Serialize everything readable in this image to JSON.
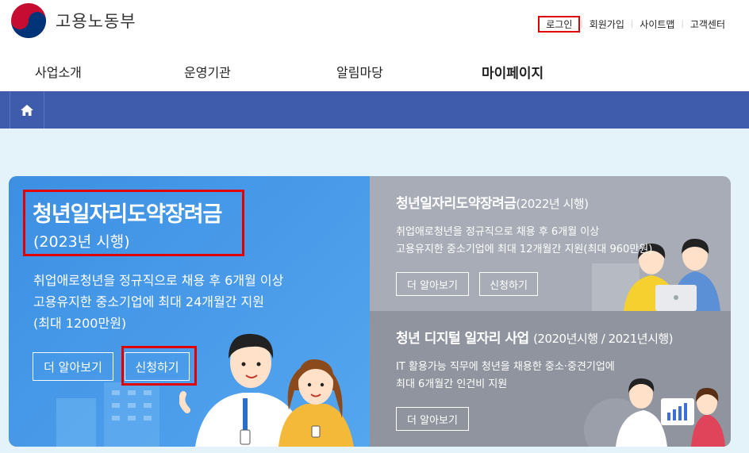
{
  "header": {
    "logo_text": "고용노동부",
    "util_links": [
      "로그인",
      "회원가입",
      "사이트맵",
      "고객센터"
    ]
  },
  "gnb": {
    "items": [
      "사업소개",
      "운영기관",
      "알림마당",
      "마이페이지"
    ]
  },
  "main": {
    "title": "청년일자리도약장려금",
    "subtitle": "(2023년 시행)",
    "desc_lines": [
      "취업애로청년을 정규직으로 채용 후 6개월 이상",
      "고용유지한 중소기업에 최대 24개월간 지원",
      "(최대 1200만원)"
    ],
    "more_label": "더 알아보기",
    "apply_label": "신청하기"
  },
  "right_top": {
    "title": "청년일자리도약장려금",
    "title_suffix": "(2022년 시행)",
    "desc_lines": [
      "취업애로청년을 정규직으로 채용 후 6개월 이상",
      "고용유지한 중소기업에 최대 12개월간 지원(최대 960만원)"
    ],
    "more_label": "더 알아보기",
    "apply_label": "신청하기"
  },
  "right_bottom": {
    "title": "청년 디지털 일자리 사업",
    "title_suffix": "(2020년시행 / 2021년시행)",
    "desc_lines": [
      "IT 활용가능 직무에 청년을 채용한 중소·중견기업에",
      "최대 6개월간 인건비 지원"
    ],
    "more_label": "더 알아보기"
  },
  "colors": {
    "nav_bar": "#3f5bab",
    "highlight": "#e00000",
    "main_card": "#4a9cec",
    "right_top_card": "#a7acb6",
    "right_bottom_card": "#8f949e"
  }
}
